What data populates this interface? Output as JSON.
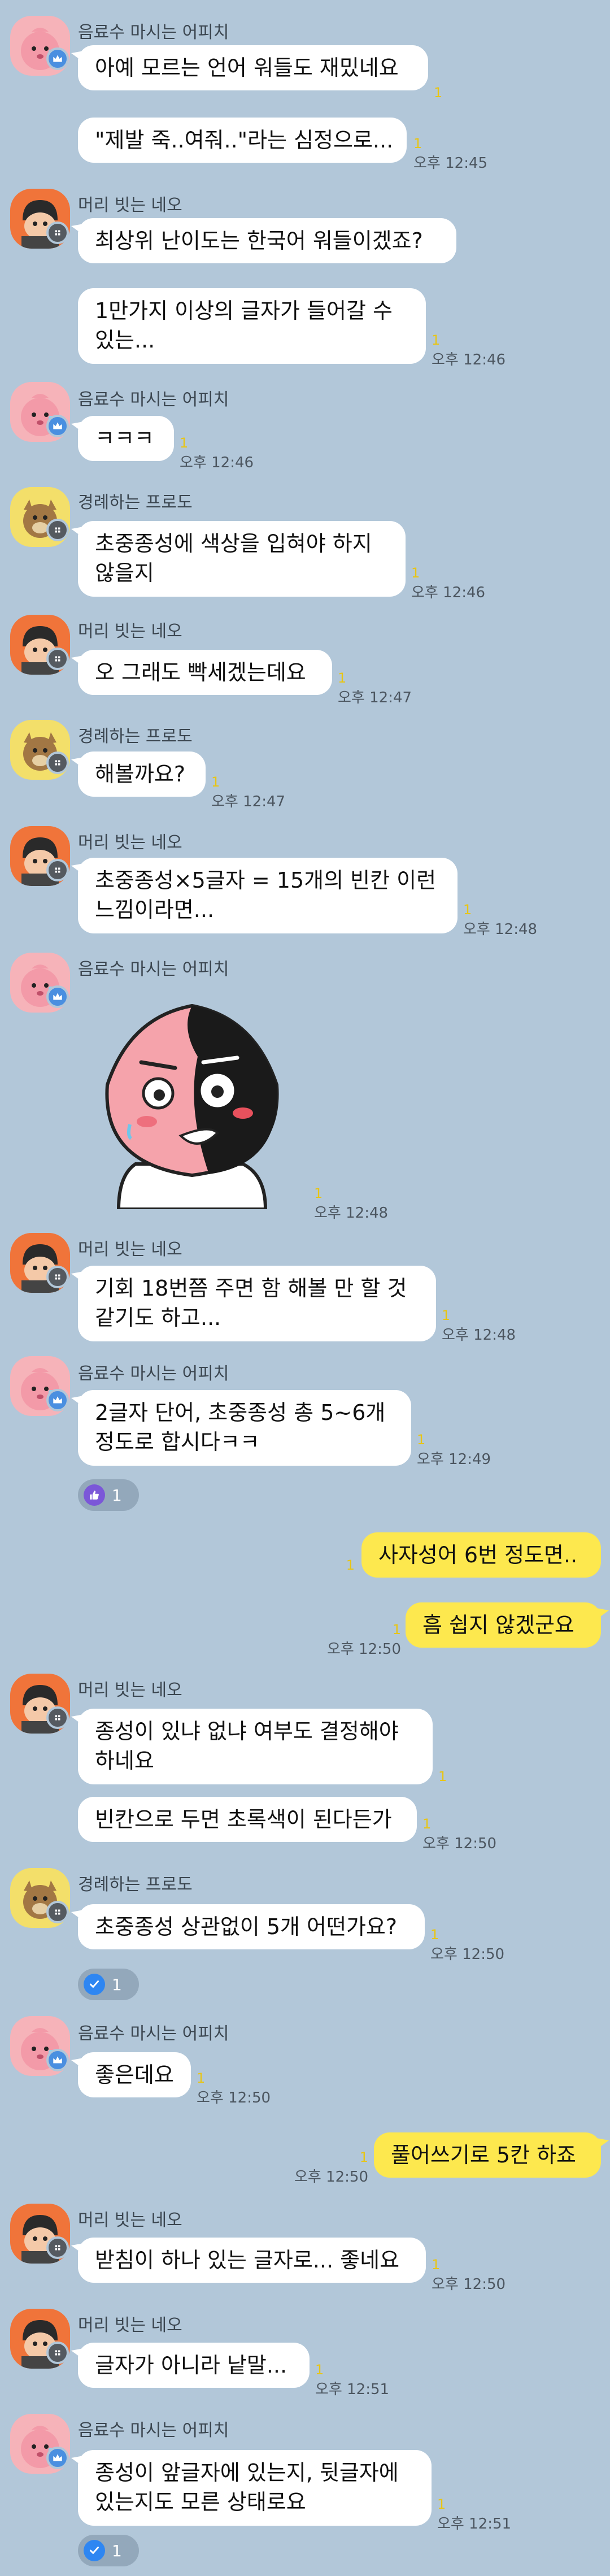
{
  "users": {
    "apeach": "음료수 마시는 어피치",
    "neo": "머리 빗는 네오",
    "frodo": "경례하는 프로도"
  },
  "unread_mark": "1",
  "messages": {
    "m1": "아예 모르는 언어 워들도 재밌네요",
    "m2": "\"제발 죽..여줘..\"라는 심정으로...",
    "t2": "오후 12:45",
    "m3": "최상위 난이도는 한국어 워들이겠죠?",
    "m4a": "1만가지 이상의 글자가 들어갈 수",
    "m4b": "있는...",
    "t4": "오후 12:46",
    "m5": "ㅋㅋㅋ",
    "t5": "오후 12:46",
    "m6a": "초중종성에 색상을 입혀야 하지",
    "m6b": "않을지",
    "t6": "오후 12:46",
    "m7": "오 그래도 빡세겠는데요",
    "t7": "오후 12:47",
    "m8": "해볼까요?",
    "t8": "오후 12:47",
    "m9a": "초중종성×5글자 = 15개의 빈칸 이런",
    "m9b": "느낌이라면...",
    "t9": "오후 12:48",
    "t10": "오후 12:48",
    "m11a": "기회 18번쯤 주면 함 해볼 만 할 것",
    "m11b": "같기도 하고...",
    "t11": "오후 12:48",
    "m12a": "2글자 단어, 초중종성 총 5~6개",
    "m12b": "정도로 합시다ㅋㅋ",
    "t12": "오후 12:49",
    "r12": "1",
    "m13": "사자성어 6번 정도면..",
    "m14": "흠 쉽지 않겠군요",
    "t14": "오후 12:50",
    "m15a": "종성이 있냐 없냐 여부도 결정해야",
    "m15b": "하네요",
    "m16": "빈칸으로 두면 초록색이 된다든가",
    "t16": "오후 12:50",
    "m17": "초중종성 상관없이 5개 어떤가요?",
    "t17": "오후 12:50",
    "r17": "1",
    "m18": "좋은데요",
    "t18": "오후 12:50",
    "m19": "풀어쓰기로 5칸 하죠",
    "t19": "오후 12:50",
    "m20": "받침이 하나 있는 글자로... 좋네요",
    "t20": "오후 12:50",
    "m21": "글자가 아니라 낱말...",
    "t21": "오후 12:51",
    "m22a": "종성이 앞글자에 있는지, 뒷글자에",
    "m22b": "있는지도 모른 상태로요",
    "t22": "오후 12:51",
    "r22": "1"
  },
  "colors": {
    "background": "#b2c7d9",
    "my_bubble": "#fde84e",
    "their_bubble": "#ffffff",
    "unread": "#e8c514"
  },
  "icons": {
    "apeach": "apeach-avatar",
    "neo": "neo-avatar",
    "frodo": "frodo-avatar",
    "crown": "crown-icon",
    "thumb": "thumbs-up-icon",
    "check": "check-icon"
  }
}
